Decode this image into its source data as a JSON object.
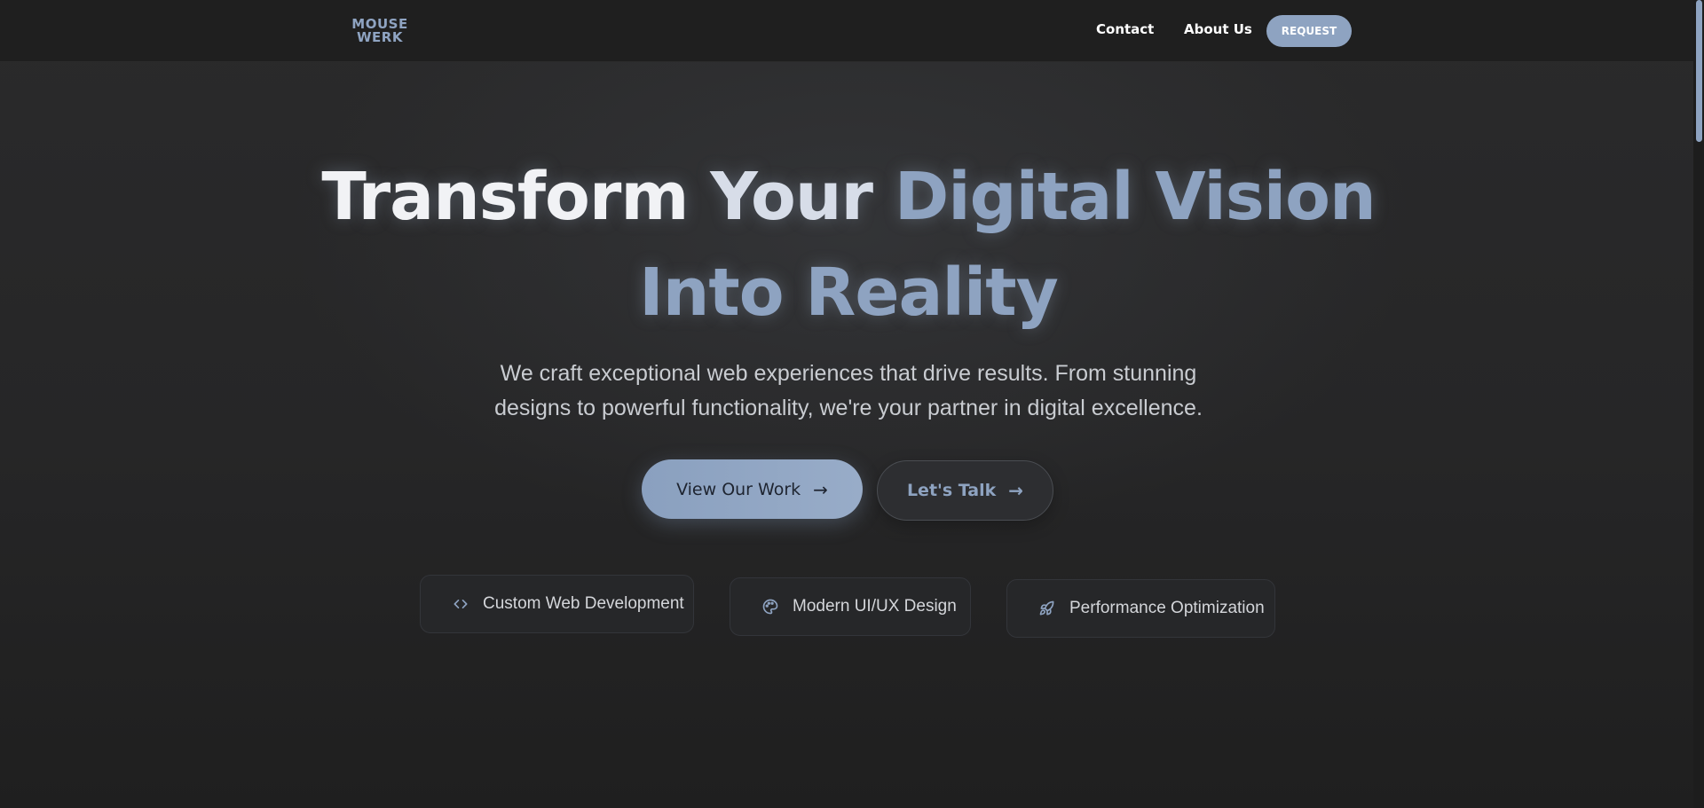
{
  "header": {
    "logo": {
      "line1": "MOUSE",
      "line2": "WERK"
    },
    "nav": [
      {
        "label": "Contact"
      },
      {
        "label": "About Us"
      }
    ],
    "request_label": "REQUEST"
  },
  "hero": {
    "title_part1": "Transform",
    "title_part2": "Your",
    "title_part3": "Digital Vision Into Reality",
    "subtitle": "We craft exceptional web experiences that drive results. From stunning designs to powerful functionality, we're your partner in digital excellence.",
    "primary_cta": "View Our Work",
    "secondary_cta": "Let's Talk"
  },
  "features": [
    {
      "label": "Custom Web Development",
      "icon": "code-icon"
    },
    {
      "label": "Modern UI/UX Design",
      "icon": "palette-icon"
    },
    {
      "label": "Performance Optimization",
      "icon": "rocket-icon"
    }
  ],
  "colors": {
    "accent": "#8ea3c1",
    "background": "#262626",
    "header": "#1f1f1f"
  }
}
